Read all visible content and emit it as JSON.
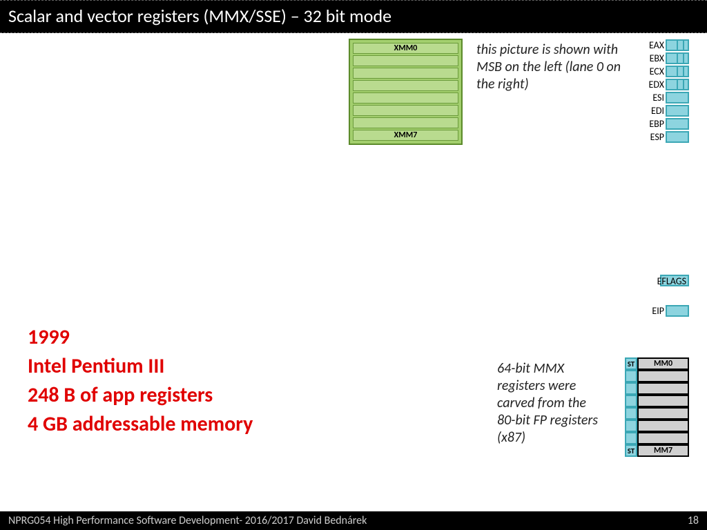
{
  "title": "Scalar and vector registers (MMX/SSE) – 32 bit mode",
  "footer": {
    "left": "NPRG054 High Performance Software Development- 2016/2017 David Bednárek",
    "page": "18"
  },
  "xmm": {
    "top": "XMM0",
    "bottom": "XMM7"
  },
  "note1": "this picture is shown with MSB on the left (lane 0 on the right)",
  "gpr": [
    "EAX",
    "EBX",
    "ECX",
    "EDX",
    "ESI",
    "EDI",
    "EBP",
    "ESP"
  ],
  "eflags": "EFLAGS",
  "eip": "EIP",
  "note2": "64-bit MMX registers were carved from the 80-bit FP registers (x87)",
  "mmx": {
    "st_top": "ST",
    "st_bottom": "ST",
    "top": "MM0",
    "bottom": "MM7"
  },
  "red": {
    "l1": "1999",
    "l2": "Intel Pentium III",
    "l3": "248 B of app registers",
    "l4": "4 GB addressable memory"
  }
}
